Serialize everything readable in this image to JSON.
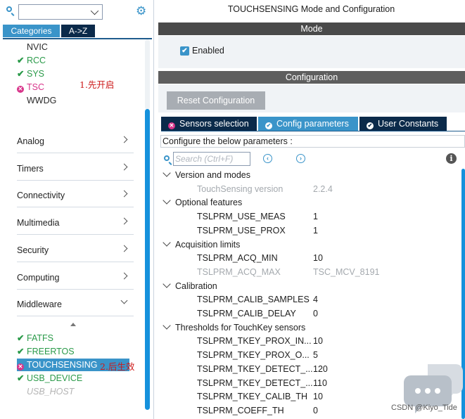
{
  "left": {
    "search": {
      "value": "",
      "placeholder": ""
    },
    "tabs": {
      "categories": "Categories",
      "az": "A->Z"
    },
    "system_items": [
      {
        "label": "NVIC",
        "status": "none"
      },
      {
        "label": "RCC",
        "status": "ok"
      },
      {
        "label": "SYS",
        "status": "ok"
      },
      {
        "label": "TSC",
        "status": "error"
      },
      {
        "label": "WWDG",
        "status": "plain"
      }
    ],
    "note1": "1.先开启",
    "categories": [
      {
        "label": "Analog",
        "expanded": false
      },
      {
        "label": "Timers",
        "expanded": false
      },
      {
        "label": "Connectivity",
        "expanded": false
      },
      {
        "label": "Multimedia",
        "expanded": false
      },
      {
        "label": "Security",
        "expanded": false
      },
      {
        "label": "Computing",
        "expanded": false
      },
      {
        "label": "Middleware",
        "expanded": true
      }
    ],
    "middleware_items": [
      {
        "label": "FATFS",
        "status": "ok"
      },
      {
        "label": "FREERTOS",
        "status": "ok"
      },
      {
        "label": "TOUCHSENSING",
        "status": "error",
        "selected": true
      },
      {
        "label": "USB_DEVICE",
        "status": "ok"
      },
      {
        "label": "USB_HOST",
        "status": "disabled"
      }
    ],
    "note2": "2.后生效"
  },
  "right": {
    "title": "TOUCHSENSING Mode and Configuration",
    "mode_label": "Mode",
    "enabled_label": "Enabled",
    "enabled_checked": true,
    "config_label": "Configuration",
    "reset_label": "Reset Configuration",
    "tabs": [
      {
        "label": "Sensors selection",
        "status": "error"
      },
      {
        "label": "Config parameters",
        "status": "ok",
        "active": true
      },
      {
        "label": "User Constants",
        "status": "ok"
      }
    ],
    "configure_text": "Configure the below parameters :",
    "search_placeholder": "Search (Ctrl+F)",
    "groups": [
      {
        "name": "Version and modes",
        "params": [
          {
            "name": "TouchSensing version",
            "value": "2.2.4",
            "disabled": true
          }
        ]
      },
      {
        "name": "Optional features",
        "params": [
          {
            "name": "TSLPRM_USE_MEAS",
            "value": "1"
          },
          {
            "name": "TSLPRM_USE_PROX",
            "value": "1"
          }
        ]
      },
      {
        "name": "Acquisition limits",
        "params": [
          {
            "name": "TSLPRM_ACQ_MIN",
            "value": "10"
          },
          {
            "name": "TSLPRM_ACQ_MAX",
            "value": "TSC_MCV_8191",
            "disabled": true
          }
        ]
      },
      {
        "name": "Calibration",
        "params": [
          {
            "name": "TSLPRM_CALIB_SAMPLES",
            "value": "4"
          },
          {
            "name": "TSLPRM_CALIB_DELAY",
            "value": "0"
          }
        ]
      },
      {
        "name": "Thresholds for TouchKey sensors",
        "params": [
          {
            "name": "TSLPRM_TKEY_PROX_IN...",
            "value": "10"
          },
          {
            "name": "TSLPRM_TKEY_PROX_O...",
            "value": "5"
          },
          {
            "name": "TSLPRM_TKEY_DETECT_...",
            "value": "120"
          },
          {
            "name": "TSLPRM_TKEY_DETECT_...",
            "value": "110"
          },
          {
            "name": "TSLPRM_TKEY_CALIB_TH",
            "value": "10"
          },
          {
            "name": "TSLPRM_COEFF_TH",
            "value": "0"
          }
        ]
      }
    ]
  },
  "watermark": "CSDN @Kiyo_Tide",
  "colors": {
    "accent": "#3a94c9",
    "dark": "#0b2a4a",
    "ok": "#2a9a49",
    "error": "#d8348a"
  }
}
